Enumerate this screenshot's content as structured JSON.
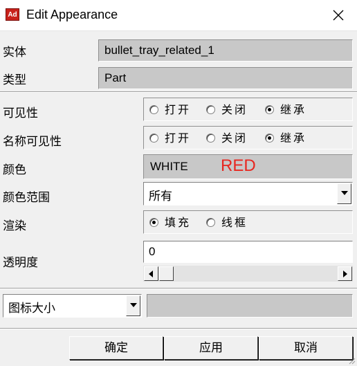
{
  "window": {
    "title": "Edit Appearance",
    "app_icon_text": "Ad"
  },
  "entity": {
    "label": "实体",
    "value": "bullet_tray_related_1"
  },
  "type": {
    "label": "类型",
    "value": "Part"
  },
  "visibility": {
    "label": "可见性",
    "options": [
      "打开",
      "关闭",
      "继承"
    ],
    "selected": "继承"
  },
  "name_visibility": {
    "label": "名称可见性",
    "options": [
      "打开",
      "关闭",
      "继承"
    ],
    "selected": "继承"
  },
  "color": {
    "label": "颜色",
    "value_text": "WHITE",
    "overlay_text": "RED",
    "overlay_color": "#e8261f"
  },
  "color_scope": {
    "label": "颜色范围",
    "value": "所有"
  },
  "render": {
    "label": "渲染",
    "options": [
      "填充",
      "线框"
    ],
    "selected": "填充"
  },
  "transparency": {
    "label": "透明度",
    "value": "0"
  },
  "icon_size": {
    "value": "图标大小"
  },
  "buttons": {
    "ok": "确定",
    "apply": "应用",
    "cancel": "取消"
  },
  "icons": {
    "app": "adams-app-icon",
    "close": "close-icon",
    "combo_arrow": "chevron-down-icon",
    "scroll_left": "arrow-left-icon",
    "scroll_right": "arrow-right-icon"
  }
}
